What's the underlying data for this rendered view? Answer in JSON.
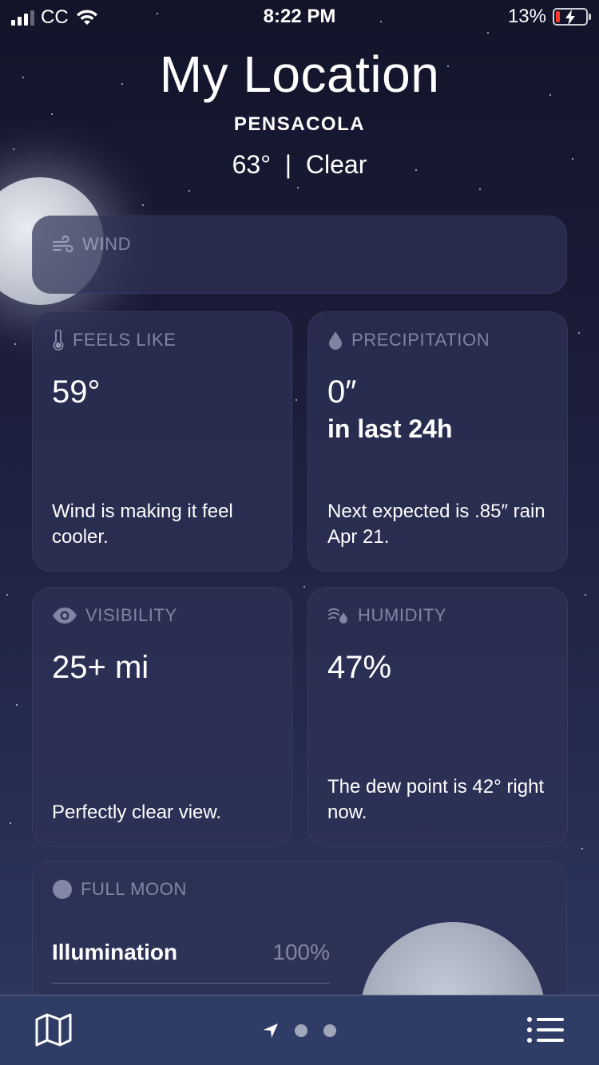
{
  "status_bar": {
    "carrier": "CC",
    "time": "8:22 PM",
    "battery_percent": "13%",
    "battery_level": 0.13,
    "icons": [
      "signal-icon",
      "wifi-icon",
      "battery-charging-icon"
    ]
  },
  "header": {
    "title": "My Location",
    "city": "PENSACOLA",
    "temperature": "63°",
    "separator": "|",
    "condition": "Clear"
  },
  "wind": {
    "label": "WIND",
    "icon": "wind-icon"
  },
  "feels_like": {
    "label": "FEELS LIKE",
    "icon": "thermometer-icon",
    "value": "59°",
    "note": "Wind is making it feel cooler."
  },
  "precipitation": {
    "label": "PRECIPITATION",
    "icon": "raindrop-icon",
    "value": "0″",
    "value_sub": "in last 24h",
    "note": "Next expected is .85″ rain Apr 21."
  },
  "visibility": {
    "label": "VISIBILITY",
    "icon": "eye-icon",
    "value": "25+ mi",
    "note": "Perfectly clear view."
  },
  "humidity": {
    "label": "HUMIDITY",
    "icon": "humidity-icon",
    "value": "47%",
    "note": "The dew point is 42° right now."
  },
  "moon": {
    "label": "FULL MOON",
    "icon": "moon-phase-icon",
    "illumination_label": "Illumination",
    "illumination_value": "100%"
  },
  "bottom_bar": {
    "icons": [
      "map-icon",
      "location-arrow-icon",
      "list-icon"
    ],
    "page_count": 3
  },
  "colors": {
    "background_top": "#13142a",
    "background_bottom": "#2e3a62",
    "card": "#2e3256",
    "muted_text": "#c8cee6",
    "battery_low": "#ff3b30",
    "bottom_bar": "#2f3d66"
  }
}
